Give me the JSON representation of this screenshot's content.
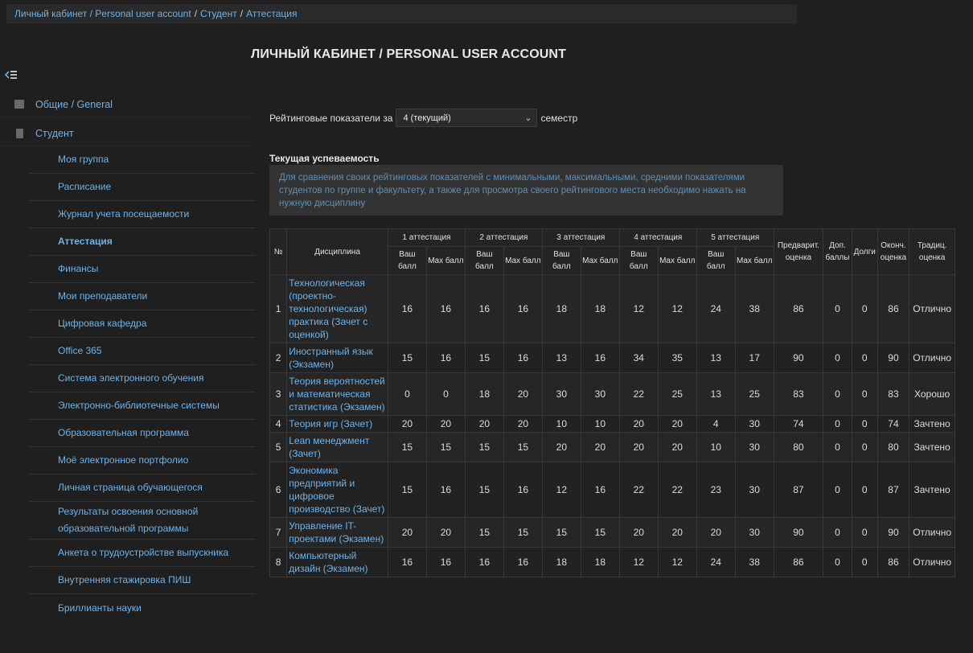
{
  "breadcrumb": [
    "Личный кабинет / Personal user account",
    "Студент",
    "Аттестация"
  ],
  "page_title": "ЛИЧНЫЙ КАБИНЕТ / PERSONAL USER ACCOUNT",
  "sidebar": {
    "top_items": [
      {
        "label": "Общие / General",
        "icon": "briefcase-icon"
      },
      {
        "label": "Студент",
        "icon": "book-icon"
      }
    ],
    "items": [
      {
        "label": "Моя группа"
      },
      {
        "label": "Расписание"
      },
      {
        "label": "Журнал учета посещаемости"
      },
      {
        "label": "Аттестация",
        "active": true
      },
      {
        "label": "Финансы"
      },
      {
        "label": "Мои преподаватели"
      },
      {
        "label": "Цифровая кафедра"
      },
      {
        "label": "Office 365"
      },
      {
        "label": "Система электронного обучения"
      },
      {
        "label": "Электронно-библиотечные системы"
      },
      {
        "label": "Образовательная программа"
      },
      {
        "label": "Моё электронное портфолио"
      },
      {
        "label": "Личная страница обучающегося"
      },
      {
        "label": "Результаты освоения основной образовательной программы"
      },
      {
        "label": "Анкета о трудоустройстве выпускника"
      },
      {
        "label": "Внутренняя стажировка ПИШ"
      },
      {
        "label": "Бриллианты науки"
      }
    ]
  },
  "rating": {
    "prefix": "Рейтинговые показатели за",
    "semester_value": "4 (текущий)",
    "suffix": "семестр"
  },
  "current_progress": {
    "title": "Текущая успеваемость",
    "hint": "Для сравнения своих рейтинговых показателей с минимальными, максимальными, средними показателями студентов по группе и факультету, а также для просмотра своего рейтингового места необходимо нажать на нужную дисциплину"
  },
  "table": {
    "headers": {
      "num": "№",
      "discipline": "Дисциплина",
      "attestations": [
        "1 аттестация",
        "2 аттестация",
        "3 аттестация",
        "4 аттестация",
        "5 аттестация"
      ],
      "your_score": "Ваш балл",
      "max_score": "Max балл",
      "prelim": "Предварит. оценка",
      "extra": "Доп. баллы",
      "debts": "Долги",
      "final": "Оконч. оценка",
      "traditional": "Традиц. оценка"
    },
    "rows": [
      {
        "n": "1",
        "discipline": "Технологическая (проектно-технологическая) практика (Зачет с оценкой)",
        "scores": [
          "16",
          "16",
          "16",
          "16",
          "18",
          "18",
          "12",
          "12",
          "24",
          "38"
        ],
        "prelim": "86",
        "extra": "0",
        "debts": "0",
        "final": "86",
        "trad": "Отлично"
      },
      {
        "n": "2",
        "discipline": "Иностранный язык (Экзамен)",
        "scores": [
          "15",
          "16",
          "15",
          "16",
          "13",
          "16",
          "34",
          "35",
          "13",
          "17"
        ],
        "prelim": "90",
        "extra": "0",
        "debts": "0",
        "final": "90",
        "trad": "Отлично"
      },
      {
        "n": "3",
        "discipline": "Теория вероятностей и математическая статистика (Экзамен)",
        "scores": [
          "0",
          "0",
          "18",
          "20",
          "30",
          "30",
          "22",
          "25",
          "13",
          "25"
        ],
        "prelim": "83",
        "extra": "0",
        "debts": "0",
        "final": "83",
        "trad": "Хорошо"
      },
      {
        "n": "4",
        "discipline": "Теория игр (Зачет)",
        "scores": [
          "20",
          "20",
          "20",
          "20",
          "10",
          "10",
          "20",
          "20",
          "4",
          "30"
        ],
        "prelim": "74",
        "extra": "0",
        "debts": "0",
        "final": "74",
        "trad": "Зачтено"
      },
      {
        "n": "5",
        "discipline": "Lean менеджмент (Зачет)",
        "scores": [
          "15",
          "15",
          "15",
          "15",
          "20",
          "20",
          "20",
          "20",
          "10",
          "30"
        ],
        "prelim": "80",
        "extra": "0",
        "debts": "0",
        "final": "80",
        "trad": "Зачтено"
      },
      {
        "n": "6",
        "discipline": "Экономика предприятий и цифровое производство (Зачет)",
        "scores": [
          "15",
          "16",
          "15",
          "16",
          "12",
          "16",
          "22",
          "22",
          "23",
          "30"
        ],
        "prelim": "87",
        "extra": "0",
        "debts": "0",
        "final": "87",
        "trad": "Зачтено"
      },
      {
        "n": "7",
        "discipline": "Управление IT-проектами (Экзамен)",
        "scores": [
          "20",
          "20",
          "15",
          "15",
          "15",
          "15",
          "20",
          "20",
          "20",
          "30"
        ],
        "prelim": "90",
        "extra": "0",
        "debts": "0",
        "final": "90",
        "trad": "Отлично"
      },
      {
        "n": "8",
        "discipline": "Компьютерный дизайн (Экзамен)",
        "scores": [
          "16",
          "16",
          "16",
          "16",
          "18",
          "18",
          "12",
          "12",
          "24",
          "38"
        ],
        "prelim": "86",
        "extra": "0",
        "debts": "0",
        "final": "86",
        "trad": "Отлично"
      }
    ]
  }
}
